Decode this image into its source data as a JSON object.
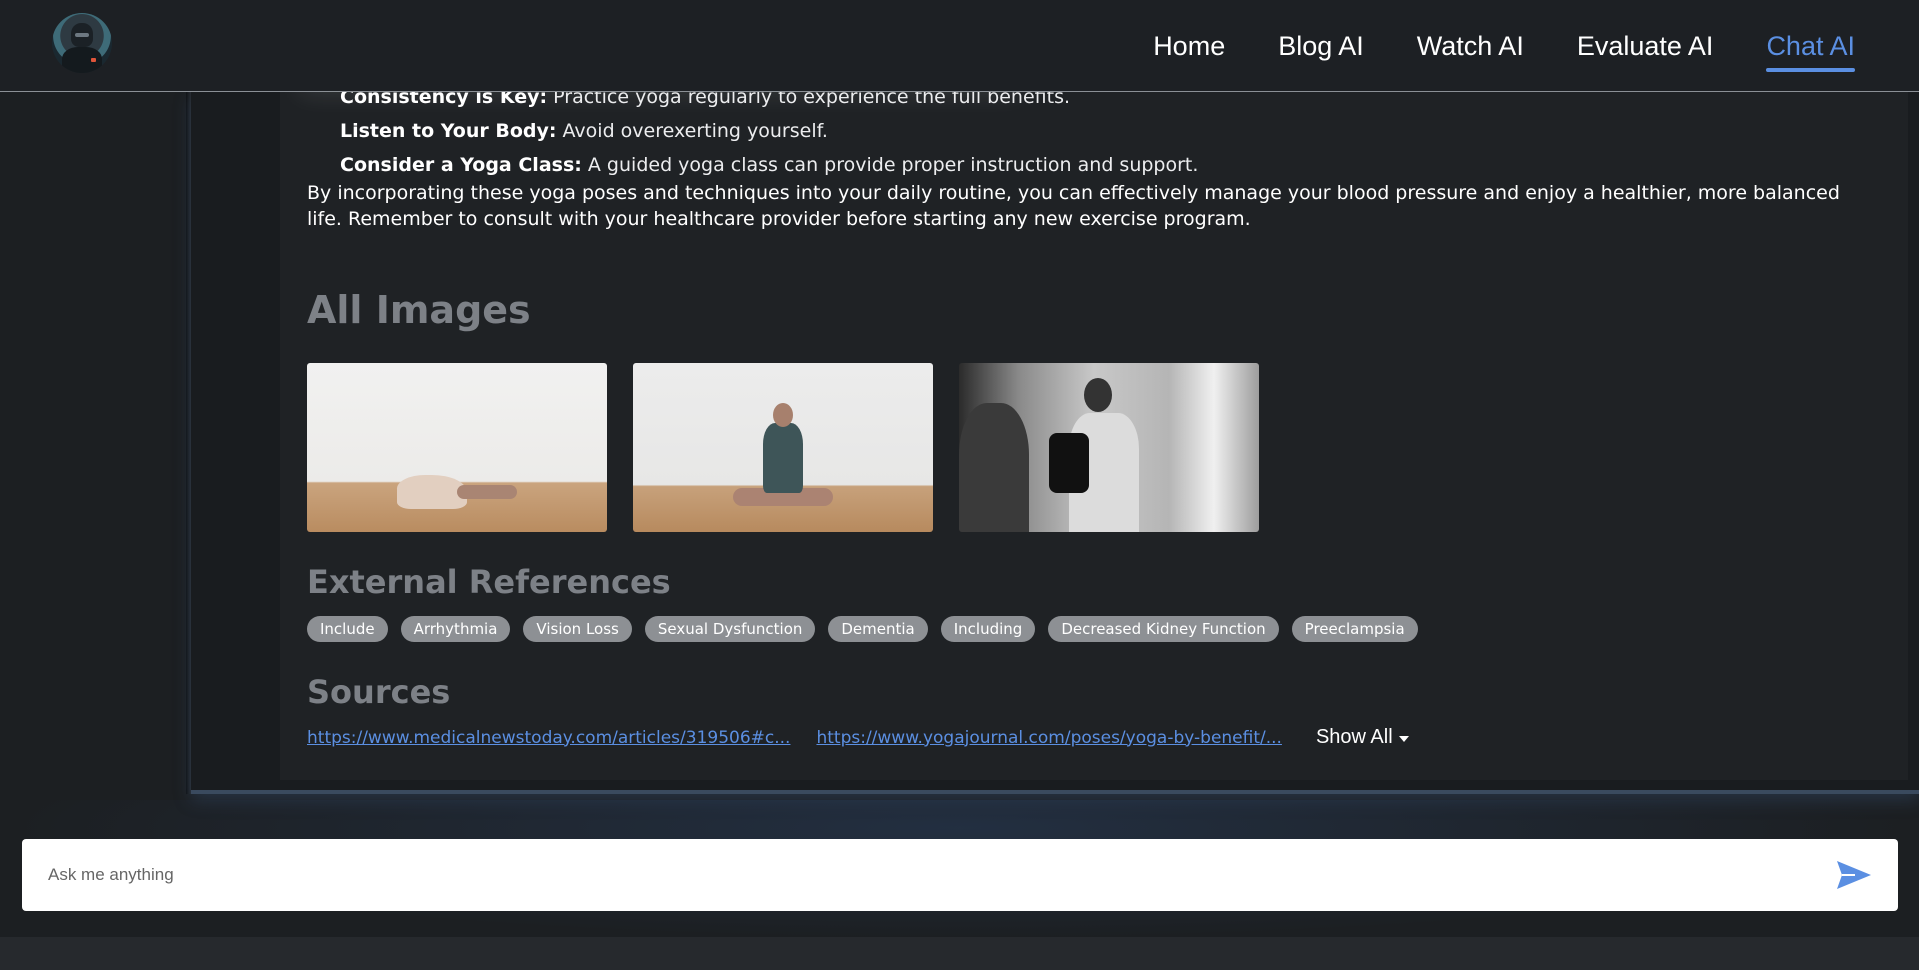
{
  "nav": {
    "items": [
      {
        "label": "Home",
        "active": false
      },
      {
        "label": "Blog AI",
        "active": false
      },
      {
        "label": "Watch AI",
        "active": false
      },
      {
        "label": "Evaluate AI",
        "active": false
      },
      {
        "label": "Chat AI",
        "active": true
      }
    ],
    "active_color": "#5b8fe2"
  },
  "content": {
    "bullets": [
      {
        "term": "Consistency is Key:",
        "text": " Practice yoga regularly to experience the full benefits."
      },
      {
        "term": "Listen to Your Body:",
        "text": " Avoid overexerting yourself."
      },
      {
        "term": "Consider a Yoga Class:",
        "text": " A guided yoga class can provide proper instruction and support."
      }
    ],
    "paragraph": "By incorporating these yoga poses and techniques into your daily routine, you can effectively manage your blood pressure and enjoy a healthier, more balanced life. Remember to consult with your healthcare provider before starting any new exercise program."
  },
  "images_section": {
    "title": "All Images"
  },
  "references": {
    "title": "External References",
    "chips": [
      "Include",
      "Arrhythmia",
      "Vision Loss",
      "Sexual Dysfunction",
      "Dementia",
      "Including",
      "Decreased Kidney Function",
      "Preeclampsia"
    ]
  },
  "sources": {
    "title": "Sources",
    "links": [
      "https://www.medicalnewstoday.com/articles/319506#c...",
      "https://www.yogajournal.com/poses/yoga-by-benefit/..."
    ],
    "show_all_label": "Show All"
  },
  "chat": {
    "placeholder": "Ask me anything",
    "send_icon": "send-icon"
  }
}
